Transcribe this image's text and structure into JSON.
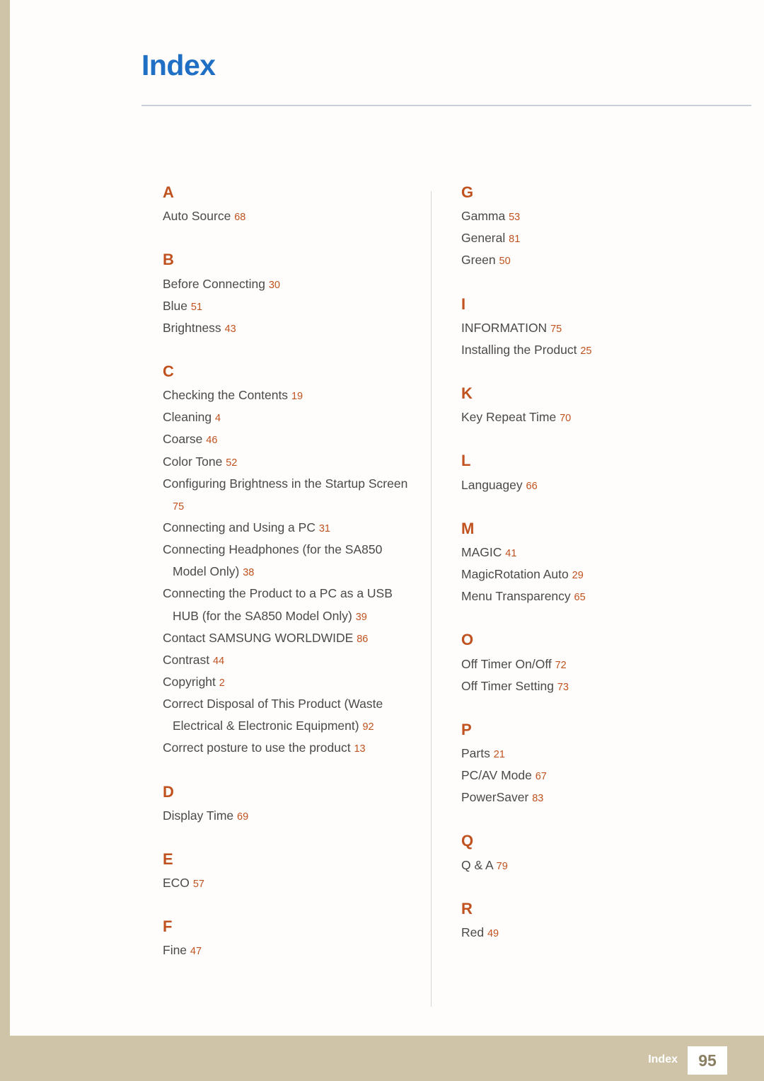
{
  "header": {
    "title": "Index"
  },
  "footer": {
    "label": "Index",
    "page": "95"
  },
  "columns": [
    {
      "groups": [
        {
          "letter": "A",
          "entries": [
            {
              "text": "Auto Source",
              "page": "68"
            }
          ]
        },
        {
          "letter": "B",
          "entries": [
            {
              "text": "Before Connecting",
              "page": "30"
            },
            {
              "text": "Blue",
              "page": "51"
            },
            {
              "text": "Brightness",
              "page": "43"
            }
          ]
        },
        {
          "letter": "C",
          "entries": [
            {
              "text": "Checking the Contents",
              "page": "19"
            },
            {
              "text": "Cleaning",
              "page": "4"
            },
            {
              "text": "Coarse",
              "page": "46"
            },
            {
              "text": "Color Tone",
              "page": "52"
            },
            {
              "text": "Configuring Brightness in the Startup Screen",
              "cont": "",
              "page": "75"
            },
            {
              "text": "Connecting and Using a PC",
              "page": "31"
            },
            {
              "text": "Connecting Headphones (for the SA850",
              "cont": "Model Only)",
              "page": "38"
            },
            {
              "text": "Connecting the Product to a PC as a USB",
              "cont": "HUB (for the SA850 Model Only)",
              "page": "39"
            },
            {
              "text": "Contact SAMSUNG WORLDWIDE",
              "page": "86"
            },
            {
              "text": "Contrast",
              "page": "44"
            },
            {
              "text": "Copyright",
              "page": "2"
            },
            {
              "text": "Correct Disposal of This Product (Waste",
              "cont": "Electrical & Electronic Equipment)",
              "page": "92"
            },
            {
              "text": "Correct posture to use the product",
              "page": "13"
            }
          ]
        },
        {
          "letter": "D",
          "entries": [
            {
              "text": "Display Time",
              "page": "69"
            }
          ]
        },
        {
          "letter": "E",
          "entries": [
            {
              "text": "ECO",
              "page": "57"
            }
          ]
        },
        {
          "letter": "F",
          "entries": [
            {
              "text": "Fine",
              "page": "47"
            }
          ]
        }
      ]
    },
    {
      "groups": [
        {
          "letter": "G",
          "entries": [
            {
              "text": "Gamma",
              "page": "53"
            },
            {
              "text": "General",
              "page": "81"
            },
            {
              "text": "Green",
              "page": "50"
            }
          ]
        },
        {
          "letter": "I",
          "entries": [
            {
              "text": "INFORMATION",
              "page": "75"
            },
            {
              "text": "Installing the Product",
              "page": "25"
            }
          ]
        },
        {
          "letter": "K",
          "entries": [
            {
              "text": "Key Repeat Time",
              "page": "70"
            }
          ]
        },
        {
          "letter": "L",
          "entries": [
            {
              "text": "Languagey",
              "page": "66"
            }
          ]
        },
        {
          "letter": "M",
          "entries": [
            {
              "text": "MAGIC",
              "page": "41"
            },
            {
              "text": "MagicRotation Auto",
              "page": "29"
            },
            {
              "text": "Menu Transparency",
              "page": "65"
            }
          ]
        },
        {
          "letter": "O",
          "entries": [
            {
              "text": "Off Timer On/Off",
              "page": "72"
            },
            {
              "text": "Off Timer Setting",
              "page": "73"
            }
          ]
        },
        {
          "letter": "P",
          "entries": [
            {
              "text": "Parts",
              "page": "21"
            },
            {
              "text": "PC/AV Mode",
              "page": "67"
            },
            {
              "text": "PowerSaver",
              "page": "83"
            }
          ]
        },
        {
          "letter": "Q",
          "entries": [
            {
              "text": "Q & A",
              "page": "79"
            }
          ]
        },
        {
          "letter": "R",
          "entries": [
            {
              "text": "Red",
              "page": "49"
            }
          ]
        }
      ]
    }
  ]
}
